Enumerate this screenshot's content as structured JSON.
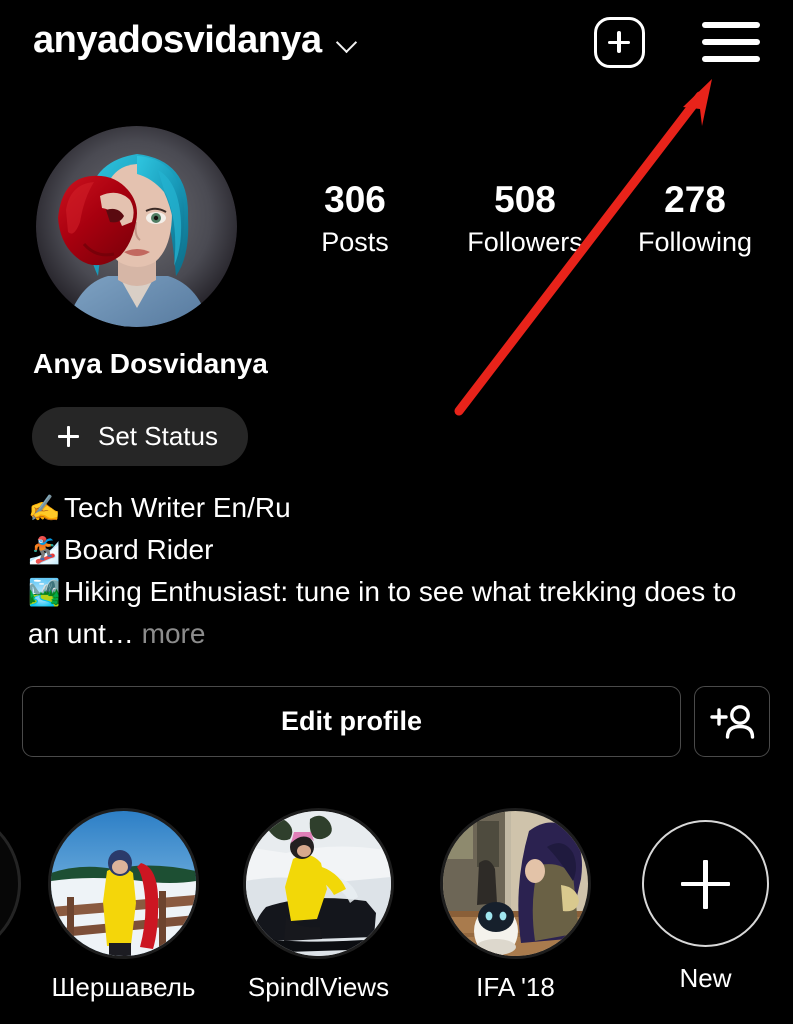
{
  "app": "Instagram profile",
  "header": {
    "username": "anyadosvidanya",
    "chevron_icon": "chevron-down-icon",
    "create_icon": "plus-square-icon",
    "menu_icon": "hamburger-menu-icon"
  },
  "profile": {
    "avatar_alt": "Woman with teal hair and red paint on face wearing denim shirt",
    "full_name": "Anya Dosvidanya",
    "set_status_label": "Set Status",
    "set_status_icon": "plus-icon",
    "stats": [
      {
        "value": "306",
        "label": "Posts"
      },
      {
        "value": "508",
        "label": "Followers"
      },
      {
        "value": "278",
        "label": "Following"
      }
    ],
    "bio": {
      "line1_emoji": "✍️",
      "line1_text": "Tech Writer En/Ru",
      "line2_emoji": "🏂",
      "line2_text": "Board Rider",
      "line3_emoji": "🏞️",
      "line3_text": "Hiking Enthusiast: tune in to see what trekking does to an unt…",
      "more_label": "more"
    }
  },
  "actions": {
    "edit_profile_label": "Edit profile",
    "add_person_icon": "add-person-icon"
  },
  "highlights": {
    "items": [
      {
        "label": "Шершавель",
        "alt": "Snowboarder in yellow jacket on snowy deck"
      },
      {
        "label": "SpindlViews",
        "alt": "Person in yellow jacket riding snowmobile"
      },
      {
        "label": "IFA '18",
        "alt": "Person with blue hair beside small white robot"
      }
    ],
    "new_label": "New",
    "new_icon": "plus-icon"
  },
  "annotation": {
    "arrow_color": "#e8231a",
    "arrow_points_to": "hamburger-menu-icon"
  }
}
